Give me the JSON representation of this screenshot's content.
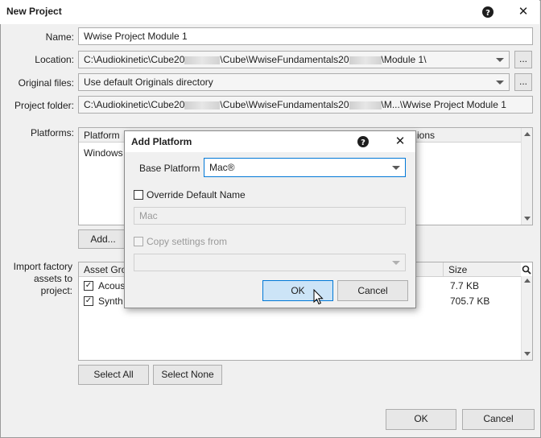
{
  "window": {
    "title": "New Project",
    "help_glyph": "?",
    "close_glyph": "✕"
  },
  "form": {
    "name_label": "Name:",
    "name_value": "Wwise Project Module 1",
    "location_label": "Location:",
    "location_prefix": "C:\\Audiokinetic\\Cube20",
    "location_mid": "\\Cube\\WwiseFundamentals20",
    "location_suffix": "\\Module 1\\",
    "browse_label": "...",
    "original_files_label": "Original files:",
    "original_files_value": "Use default Originals directory",
    "project_folder_label": "Project folder:",
    "project_folder_prefix": "C:\\Audiokinetic\\Cube20",
    "project_folder_mid": "\\Cube\\WwiseFundamentals20",
    "project_folder_suffix": "\\M...\\Wwise Project Module 1"
  },
  "platforms": {
    "label": "Platforms:",
    "col_platform": "Platform",
    "col_options": "ions",
    "rows": [
      "Windows"
    ],
    "add_button": "Add..."
  },
  "factory": {
    "label_line1": "Import factory",
    "label_line2": "assets to",
    "label_line3": "project:",
    "col_asset": "Asset Gro",
    "col_size": "Size",
    "rows": [
      {
        "name": "Acous",
        "size": "7.7 KB",
        "checked": "✓"
      },
      {
        "name": "Synth",
        "size": "705.7 KB",
        "checked": "✓"
      }
    ],
    "select_all": "Select All",
    "select_none": "Select None"
  },
  "footer": {
    "ok": "OK",
    "cancel": "Cancel"
  },
  "add_platform_dialog": {
    "title": "Add Platform",
    "help_glyph": "?",
    "close_glyph": "✕",
    "base_platform_label": "Base Platform",
    "base_platform_value": "Mac®",
    "override_label": "Override Default Name",
    "name_placeholder": "Mac",
    "copy_settings_label": "Copy settings from",
    "ok": "OK",
    "cancel": "Cancel"
  },
  "colors": {
    "accent": "#0078d7",
    "ok_focus": "#cce4f7"
  }
}
